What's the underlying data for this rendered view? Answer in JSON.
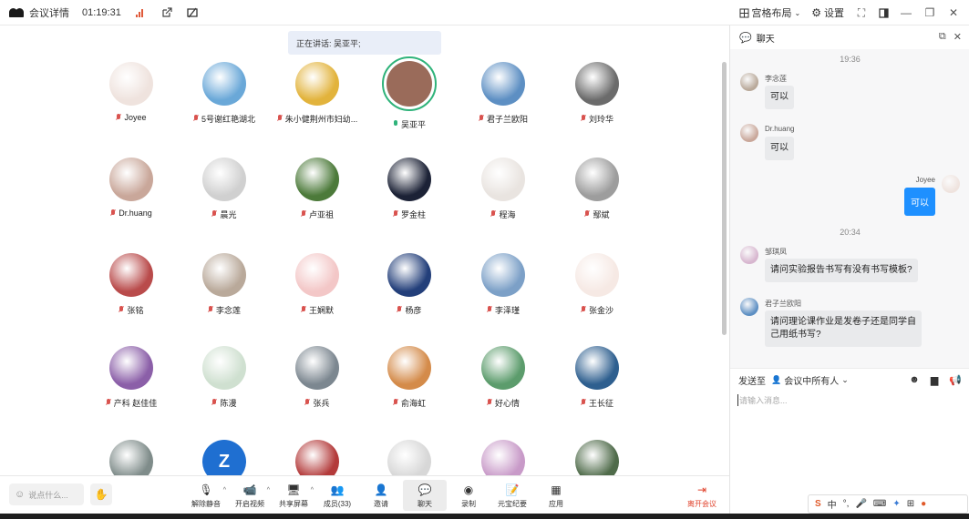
{
  "topbar": {
    "title": "会议详情",
    "time": "01:19:31",
    "layout_label": "宫格布局",
    "settings_label": "设置"
  },
  "gallery": {
    "speaking_label": "正在讲话: 吴亚平;",
    "participants": [
      {
        "name": "Joyee",
        "mic": "off",
        "color": "#efe3de"
      },
      {
        "name": "5号谢红艳湖北",
        "mic": "off",
        "color": "#6aa8d8"
      },
      {
        "name": "朱小健荆州市妇幼...",
        "mic": "off",
        "color": "#e2b33c"
      },
      {
        "name": "吴亚平",
        "mic": "on",
        "color": "#9a6b5a"
      },
      {
        "name": "君子兰欧阳",
        "mic": "off",
        "color": "#5d8fc3"
      },
      {
        "name": "刘玲华",
        "mic": "off",
        "color": "#6b6b6b"
      },
      {
        "name": "Dr.huang",
        "mic": "off",
        "color": "#c9a79a"
      },
      {
        "name": "晨光",
        "mic": "off",
        "color": "#d0d0d0"
      },
      {
        "name": "卢亚祖",
        "mic": "off",
        "color": "#4c7a3a"
      },
      {
        "name": "罗金柱",
        "mic": "off",
        "color": "#1c2236"
      },
      {
        "name": "程海",
        "mic": "off",
        "color": "#e9e4e0"
      },
      {
        "name": "鄢斌",
        "mic": "off",
        "color": "#9d9d9d"
      },
      {
        "name": "张铭",
        "mic": "off",
        "color": "#b94b4b"
      },
      {
        "name": "李念莲",
        "mic": "off",
        "color": "#b9a99a"
      },
      {
        "name": "王娴默",
        "mic": "off",
        "color": "#f3c7c7"
      },
      {
        "name": "杨彦",
        "mic": "off",
        "color": "#233f7a"
      },
      {
        "name": "李泽瑾",
        "mic": "off",
        "color": "#7ca0c7"
      },
      {
        "name": "张金沙",
        "mic": "off",
        "color": "#f6e9e4"
      },
      {
        "name": "产科 赵佳佳",
        "mic": "off",
        "color": "#8b5fa8"
      },
      {
        "name": "陈漫",
        "mic": "off",
        "color": "#cfe0d0"
      },
      {
        "name": "张兵",
        "mic": "off",
        "color": "#7c8790"
      },
      {
        "name": "俞海虹",
        "mic": "off",
        "color": "#d48b4a"
      },
      {
        "name": "好心情",
        "mic": "off",
        "color": "#5c9c6c"
      },
      {
        "name": "王长征",
        "mic": "off",
        "color": "#2e5f8f"
      }
    ],
    "partial_row_colors": [
      "#7f8c8a",
      "#1f6fd1",
      "#b33a3a",
      "#d7d7d7",
      "#c89ac8",
      "#4f6b4a"
    ],
    "z_avatar_letter": "Z"
  },
  "bottombar": {
    "say_placeholder": "说点什么...",
    "tools": [
      {
        "label": "解除静音",
        "icon": "mic-off-icon",
        "glyph": "🎙",
        "caret": true
      },
      {
        "label": "开启视频",
        "icon": "video-off-icon",
        "glyph": "📹",
        "caret": true
      },
      {
        "label": "共享屏幕",
        "icon": "share-screen-icon",
        "glyph": "🖥",
        "caret": true
      },
      {
        "label": "成员(33)",
        "icon": "members-icon",
        "glyph": "👥",
        "caret": false
      },
      {
        "label": "邀请",
        "icon": "invite-icon",
        "glyph": "👤",
        "caret": false
      },
      {
        "label": "聊天",
        "icon": "chat-icon",
        "glyph": "💬",
        "caret": false
      },
      {
        "label": "录制",
        "icon": "record-icon",
        "glyph": "◉",
        "caret": false
      },
      {
        "label": "元宝纪要",
        "icon": "summary-icon",
        "glyph": "📝",
        "caret": false
      },
      {
        "label": "应用",
        "icon": "apps-icon",
        "glyph": "▦",
        "caret": false
      }
    ],
    "leave_label": "离开会议"
  },
  "chat": {
    "title": "聊天",
    "time1": "19:36",
    "time2": "20:34",
    "messages": [
      {
        "name": "李念莲",
        "text": "可以",
        "color": "#b9a99a"
      },
      {
        "name": "Dr.huang",
        "text": "可以",
        "color": "#c9a79a"
      },
      {
        "name": "邹琪凤",
        "text": "请问实验报告书写有没有书写模板?",
        "color": "#d7b6cf"
      },
      {
        "name": "君子兰欧阳",
        "text": "请问理论课作业是发卷子还是同学自己用纸书写?",
        "color": "#5d8fc3"
      }
    ],
    "self_message": {
      "name": "Joyee",
      "text": "可以",
      "color": "#efe3de"
    },
    "send_to_label": "发送至",
    "send_target": "会议中所有人",
    "input_placeholder": "请输入消息..."
  }
}
